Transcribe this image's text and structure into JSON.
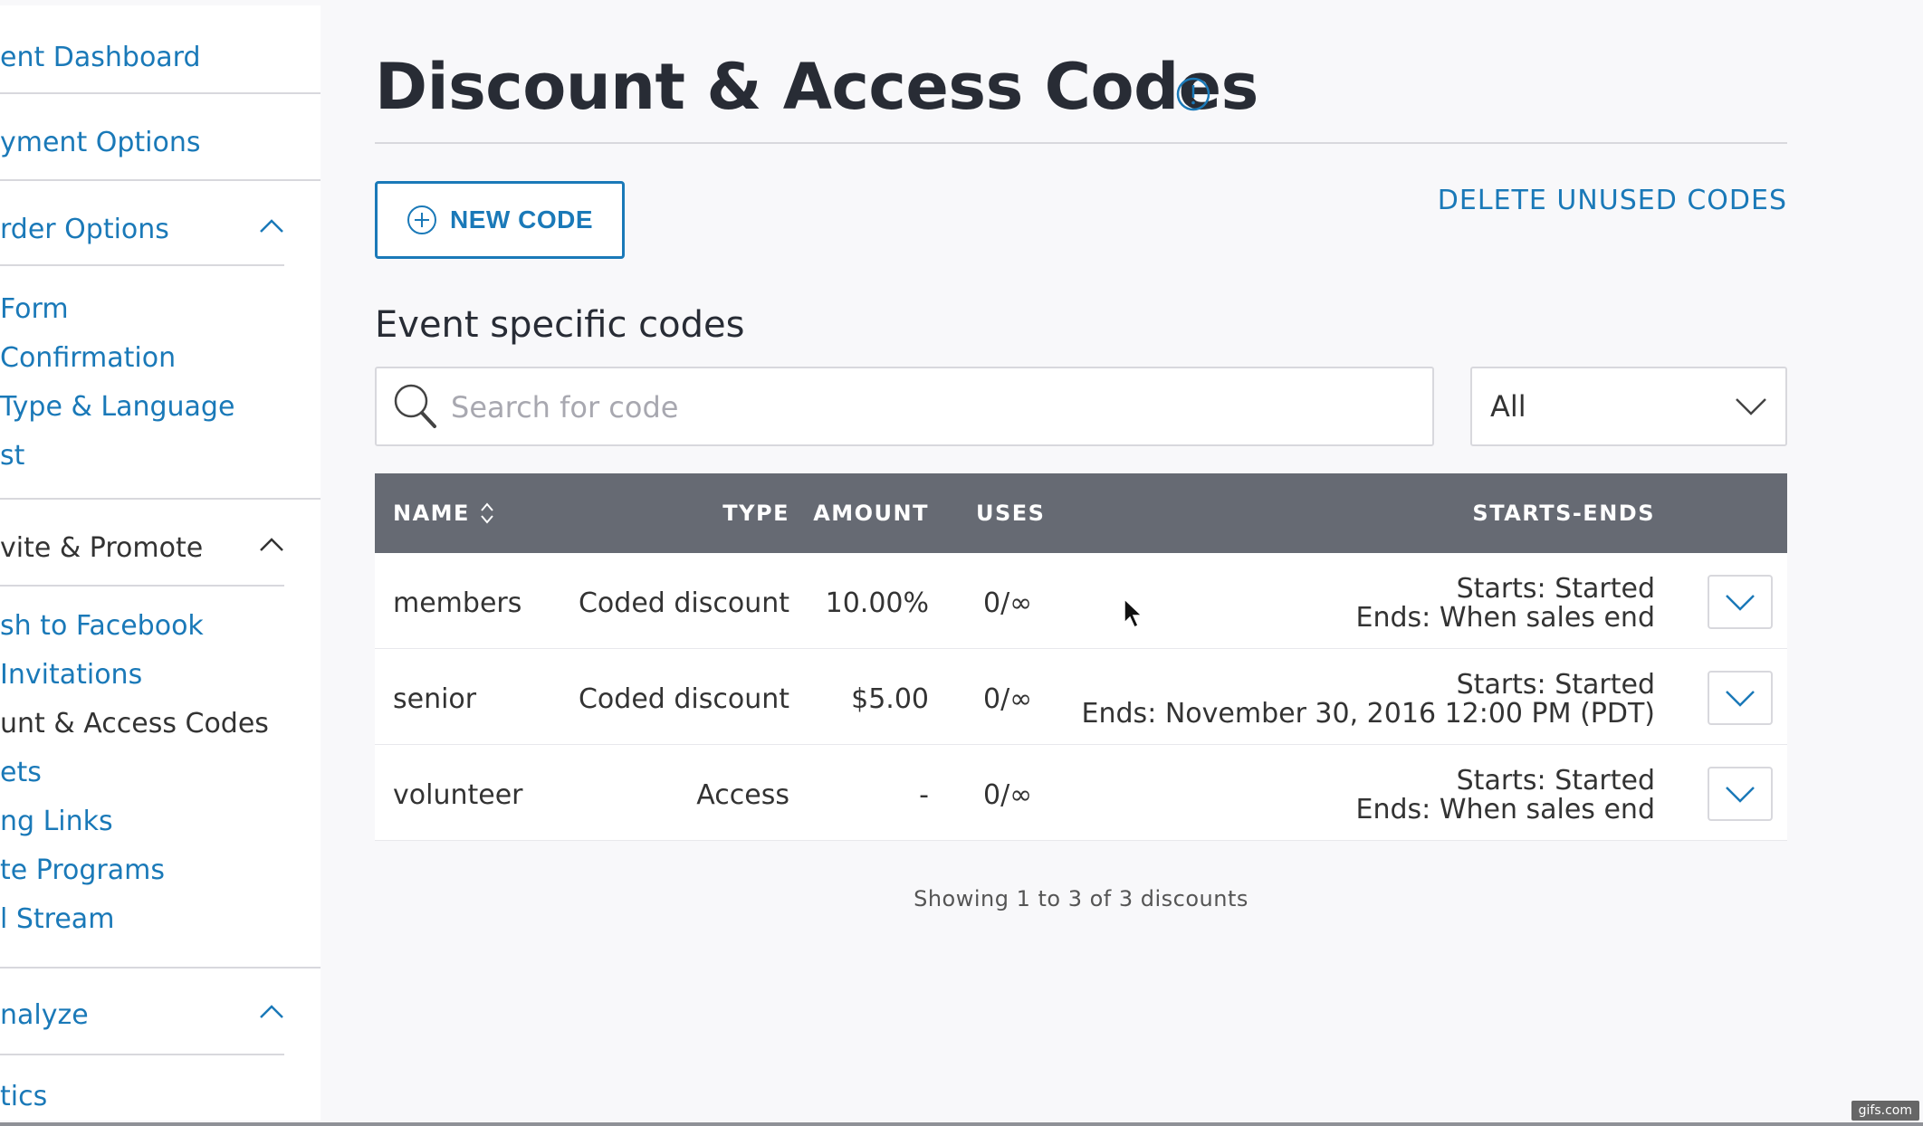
{
  "sidebar": {
    "top_links": [
      {
        "label": "ent Dashboard"
      },
      {
        "label": "yment Options"
      }
    ],
    "sections": [
      {
        "title": "rder Options",
        "items": [
          {
            "label": " Form"
          },
          {
            "label": " Confirmation"
          },
          {
            "label": " Type & Language"
          },
          {
            "label": "st"
          }
        ]
      },
      {
        "title": "vite & Promote",
        "items": [
          {
            "label": "sh to Facebook"
          },
          {
            "label": " Invitations"
          },
          {
            "label": "unt & Access Codes"
          },
          {
            "label": "ets"
          },
          {
            "label": "ng Links"
          },
          {
            "label": "te Programs"
          },
          {
            "label": "l Stream"
          }
        ]
      },
      {
        "title": "nalyze",
        "items": [
          {
            "label": "tics"
          }
        ]
      }
    ]
  },
  "main": {
    "title": "Discount & Access Codes",
    "new_code_label": "NEW CODE",
    "delete_unused_label": "DELETE UNUSED CODES",
    "section_heading": "Event specific codes",
    "search": {
      "placeholder": "Search for code",
      "value": ""
    },
    "filter": {
      "selected": "All"
    },
    "table": {
      "headers": {
        "name": "NAME",
        "type": "TYPE",
        "amount": "AMOUNT",
        "uses": "USES",
        "starts_ends": "STARTS-ENDS"
      },
      "rows": [
        {
          "name": "members",
          "type": "Coded discount",
          "amount": "10.00%",
          "uses": "0/∞",
          "starts": "Starts: Started",
          "ends": "Ends: When sales end"
        },
        {
          "name": "senior",
          "type": "Coded discount",
          "amount": "$5.00",
          "uses": "0/∞",
          "starts": "Starts: Started",
          "ends": "Ends: November 30, 2016 12:00 PM (PDT)"
        },
        {
          "name": "volunteer",
          "type": "Access",
          "amount": "-",
          "uses": "0/∞",
          "starts": "Starts: Started",
          "ends": "Ends: When sales end"
        }
      ]
    },
    "footer": "Showing 1 to 3 of 3 discounts"
  },
  "watermark": "gifs.com",
  "colors": {
    "accent": "#1a79b8",
    "table_header": "#666a73",
    "title": "#282c35"
  }
}
